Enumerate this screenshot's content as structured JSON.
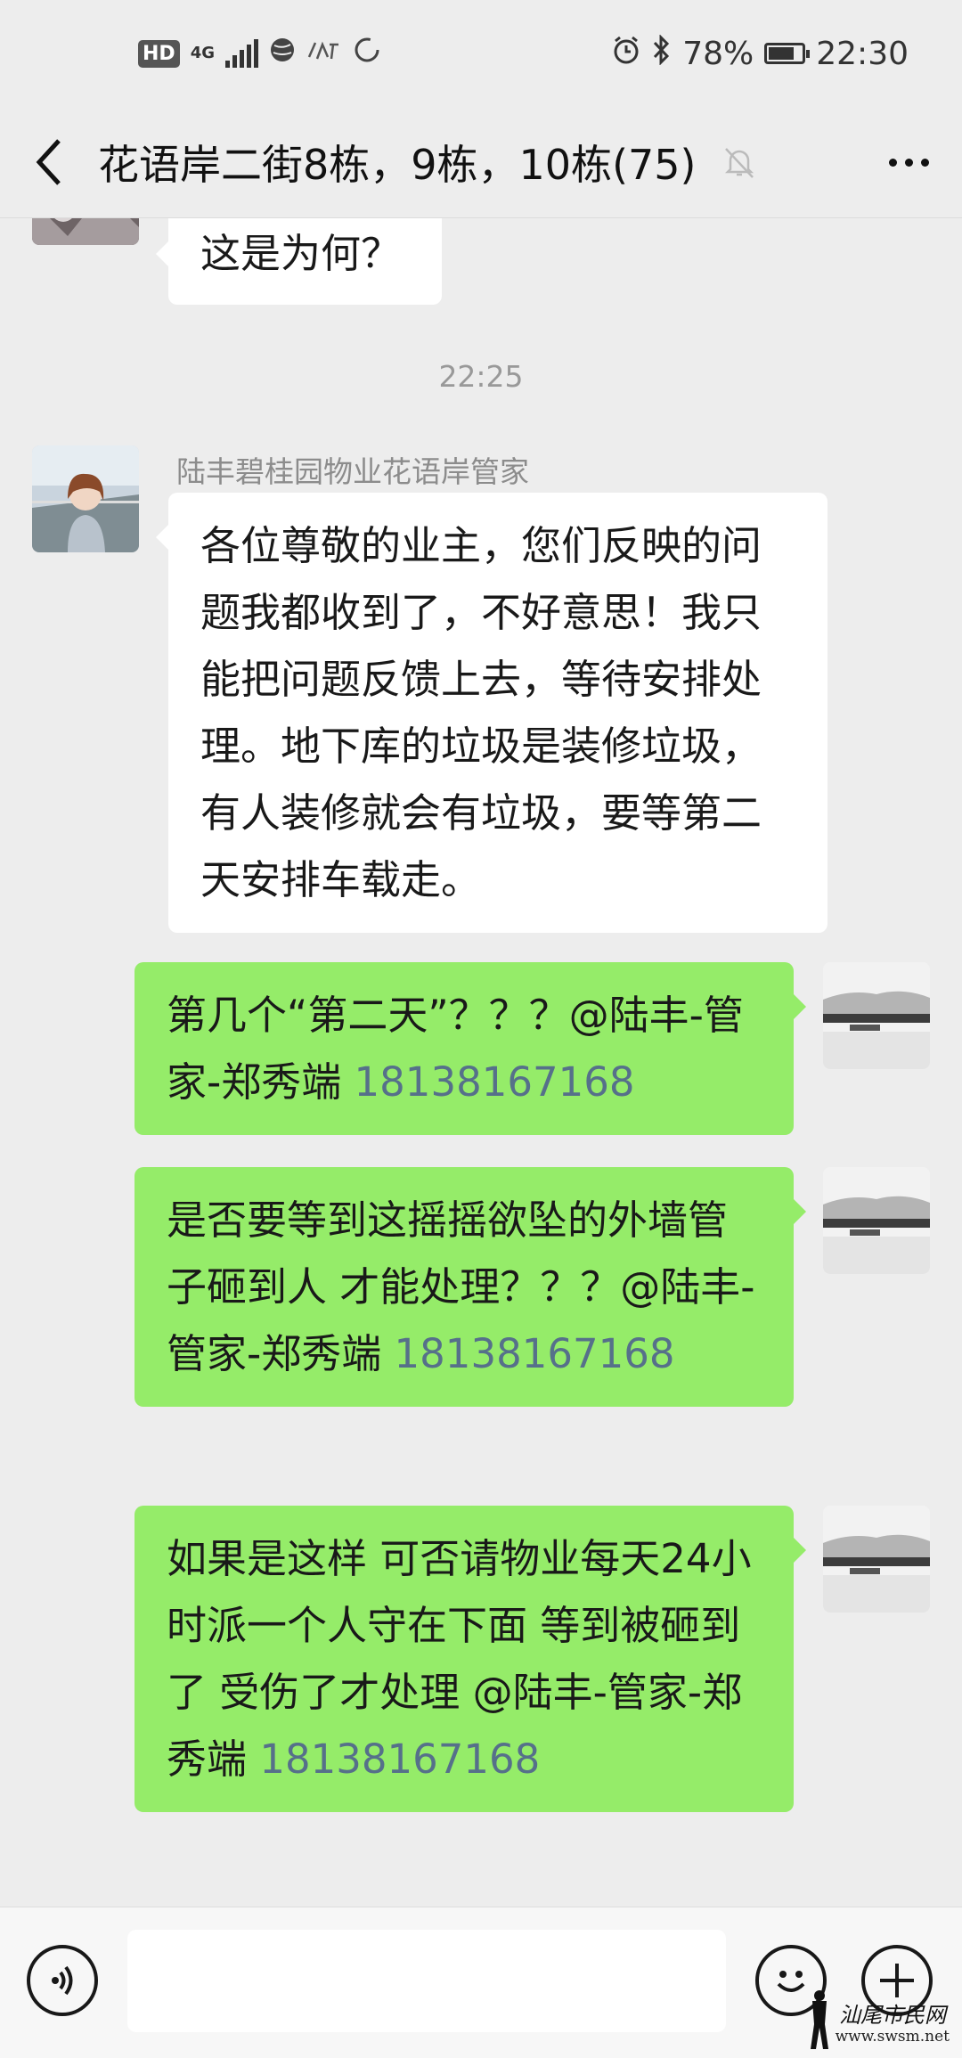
{
  "status_bar": {
    "hd": "HD",
    "network": "4G",
    "battery": "78%",
    "battery_level": 0.78,
    "time": "22:30"
  },
  "header": {
    "title": "花语岸二街8栋，9栋，10栋(75)"
  },
  "messages": {
    "prev_tail": "这是为何？",
    "timestamp": "22:25",
    "sender_name": "陆丰碧桂园物业花语岸管家",
    "notice": "各位尊敬的业主，您们反映的问题我都收到了，不好意思！我只能把问题反馈上去，等待安排处理。地下库的垃圾是装修垃圾，有人装修就会有垃圾，要等第二天安排车载走。",
    "reply1": {
      "text": "第几个“第二天”？？？@陆丰-管家-郑秀端 ",
      "phone": "18138167168"
    },
    "reply2": {
      "text": "是否要等到这摇摇欲坠的外墙管子砸到人  才能处理？？？@陆丰-管家-郑秀端 ",
      "phone": "18138167168"
    },
    "reply3": {
      "text": "如果是这样  可否请物业每天24小时派一个人守在下面 等到被砸到了 受伤了才处理 @陆丰-管家-郑秀端 ",
      "phone": "18138167168"
    }
  },
  "watermark": {
    "brand": "汕尾市民网",
    "site": "www.swsm.net"
  },
  "colors": {
    "outgoing_bubble": "#95ec69",
    "incoming_bubble": "#ffffff",
    "background": "#ededed",
    "link": "#56708a"
  },
  "icons": [
    "back-arrow-icon",
    "mute-bell-icon",
    "more-icon",
    "voice-icon",
    "emoji-icon",
    "plus-icon"
  ]
}
